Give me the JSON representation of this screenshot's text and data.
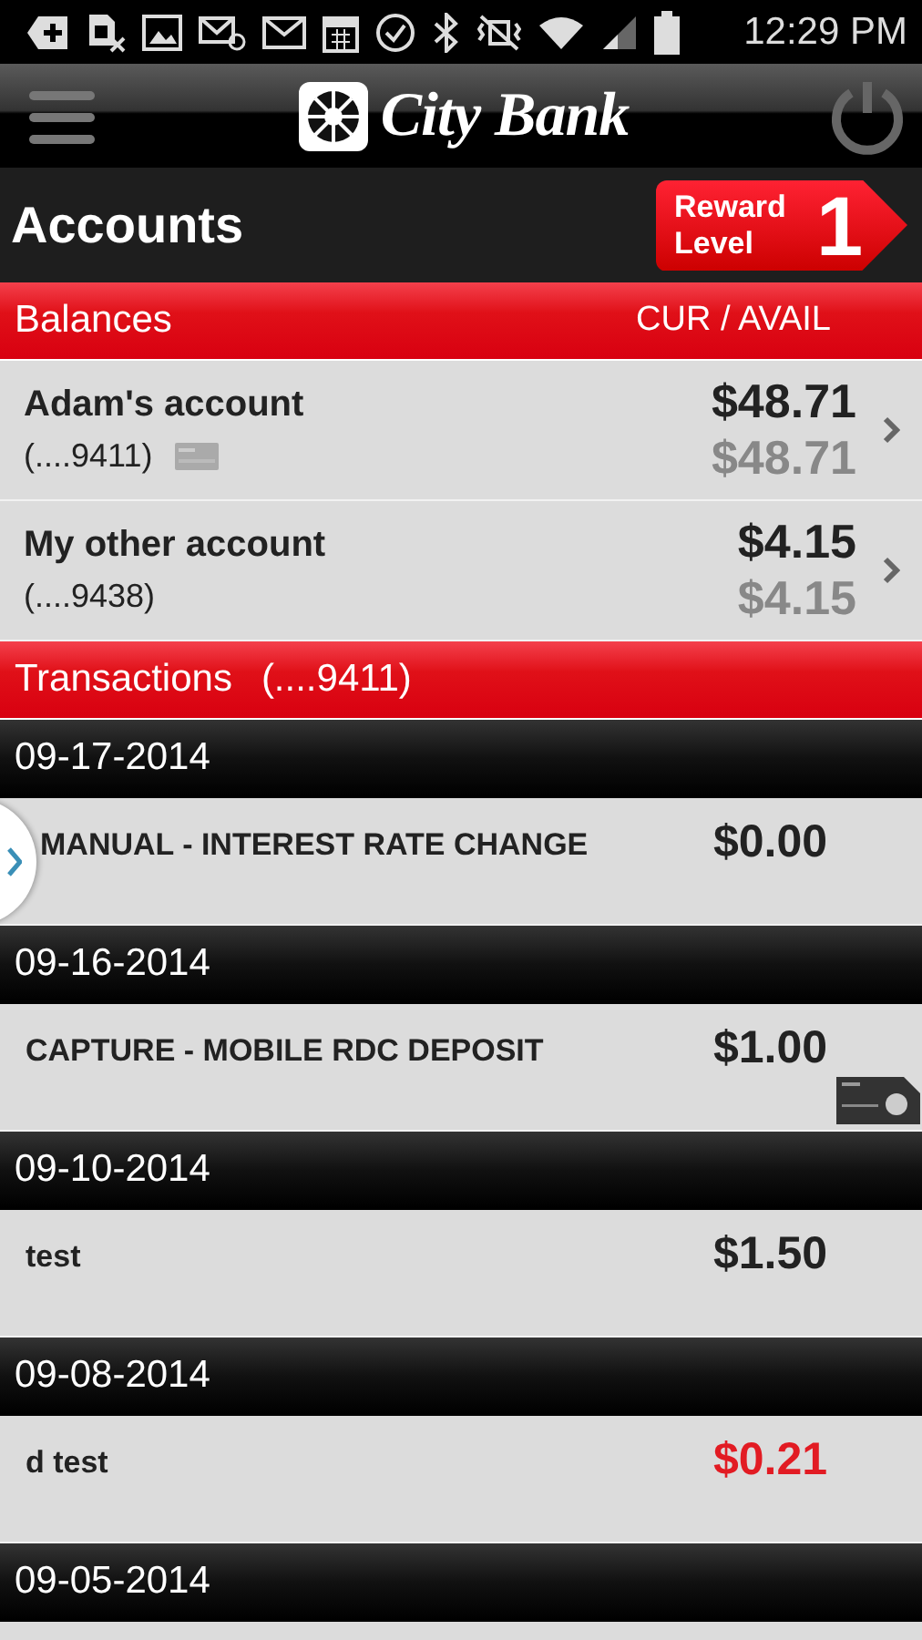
{
  "status_bar": {
    "time": "12:29 PM"
  },
  "app_bar": {
    "logo_text": "City Bank"
  },
  "page": {
    "title": "Accounts",
    "reward": {
      "label": "Reward Level",
      "level_text": "1"
    }
  },
  "balances": {
    "title": "Balances",
    "columns_label": "CUR / AVAIL",
    "accounts": [
      {
        "name": "Adam's account",
        "number": "(....9411)",
        "card": true,
        "current": "$48.71",
        "available": "$48.71"
      },
      {
        "name": "My other account",
        "number": "(....9438)",
        "card": false,
        "current": "$4.15",
        "available": "$4.15"
      }
    ]
  },
  "transactions": {
    "title": "Transactions",
    "account": "(....9411)",
    "groups": [
      {
        "date": "09-17-2014",
        "items": [
          {
            "description": "MANUAL - INTEREST RATE CHANGE",
            "amount": "$0.00",
            "negative": false,
            "image": false
          }
        ]
      },
      {
        "date": "09-16-2014",
        "items": [
          {
            "description": "CAPTURE - MOBILE RDC DEPOSIT",
            "amount": "$1.00",
            "negative": false,
            "image": true
          }
        ]
      },
      {
        "date": "09-10-2014",
        "items": [
          {
            "description": "test",
            "amount": "$1.50",
            "negative": false,
            "image": false
          }
        ]
      },
      {
        "date": "09-08-2014",
        "items": [
          {
            "description": "d test",
            "amount": "$0.21",
            "negative": true,
            "image": false
          }
        ]
      },
      {
        "date": "09-05-2014"
      }
    ]
  }
}
